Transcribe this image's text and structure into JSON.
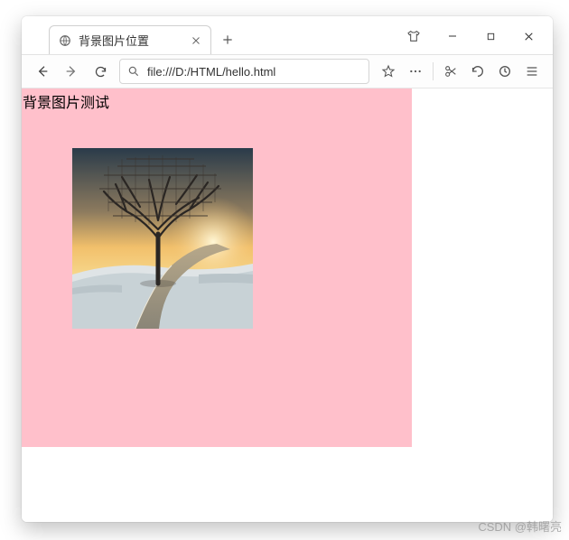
{
  "window": {
    "tab_title": "背景图片位置",
    "url": "file:///D:/HTML/hello.html"
  },
  "page": {
    "heading": "背景图片测试",
    "bg_color": "#ffc0cb"
  },
  "icons": {
    "globe": "globe-icon",
    "close_tab": "close-icon",
    "new_tab": "plus-icon",
    "tshirt": "tshirt-icon",
    "minimize": "minimize-icon",
    "maximize": "maximize-icon",
    "close_win": "close-icon",
    "back": "arrow-left-icon",
    "forward": "arrow-right-icon",
    "reload": "reload-icon",
    "search": "search-icon",
    "star": "star-icon",
    "dots": "more-icon",
    "scissors": "scissors-icon",
    "undo": "undo-icon",
    "clock": "clock-icon",
    "menu": "menu-icon"
  },
  "watermark": "CSDN @韩曙亮"
}
